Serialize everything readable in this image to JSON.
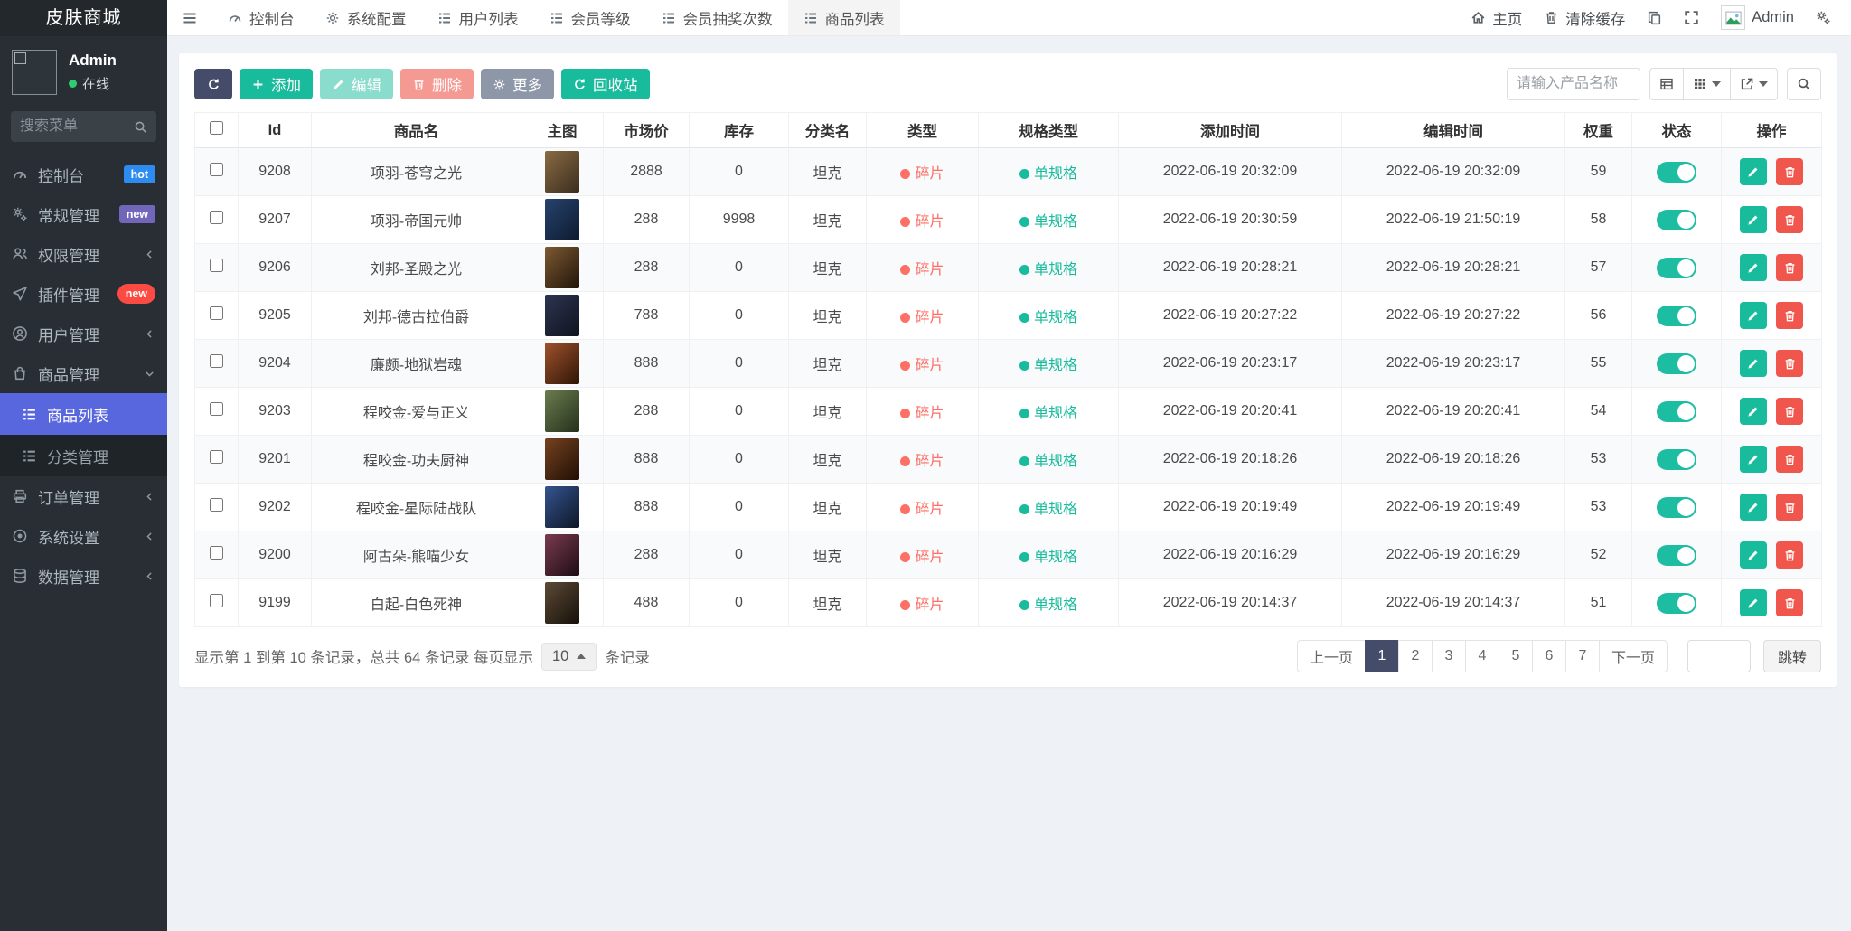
{
  "app": {
    "title": "皮肤商城"
  },
  "colors": {
    "teal": "#18bc9c",
    "danger_red": "#f0564c",
    "dark_navy": "#444c69",
    "muted_gray": "#8d97a8",
    "sidebar_active_blue": "#5867dd",
    "badge_hot_blue": "#2d8cf0",
    "badge_new_purple": "#7266ba",
    "badge_new_red": "#fb4b43",
    "type_red": "#fd7065",
    "type_green": "#18bc9c",
    "toggle_green": "#1dbda1"
  },
  "user_panel": {
    "name": "Admin",
    "status": "在线"
  },
  "sidebar": {
    "search_placeholder": "搜索菜单",
    "items": [
      {
        "label": "控制台",
        "badge": "hot"
      },
      {
        "label": "常规管理",
        "badge": "new"
      },
      {
        "label": "权限管理"
      },
      {
        "label": "插件管理",
        "badge": "new"
      },
      {
        "label": "用户管理"
      },
      {
        "label": "商品管理"
      },
      {
        "label": "订单管理"
      },
      {
        "label": "系统设置"
      },
      {
        "label": "数据管理"
      }
    ],
    "subitems": [
      {
        "label": "商品列表",
        "active": true
      },
      {
        "label": "分类管理"
      }
    ]
  },
  "navbar": {
    "tabs": [
      {
        "label": "控制台"
      },
      {
        "label": "系统配置"
      },
      {
        "label": "用户列表"
      },
      {
        "label": "会员等级"
      },
      {
        "label": "会员抽奖次数"
      },
      {
        "label": "商品列表"
      }
    ],
    "home": "主页",
    "clear_cache": "清除缓存",
    "user": "Admin"
  },
  "toolbar": {
    "add": "添加",
    "edit": "编辑",
    "delete": "删除",
    "more": "更多",
    "recycle": "回收站",
    "search_placeholder": "请输入产品名称"
  },
  "table": {
    "headers": [
      "Id",
      "商品名",
      "主图",
      "市场价",
      "库存",
      "分类名",
      "类型",
      "规格类型",
      "添加时间",
      "编辑时间",
      "权重",
      "状态",
      "操作"
    ],
    "rows": [
      {
        "id": "9208",
        "name": "项羽-苍穹之光",
        "price": "2888",
        "stock": "0",
        "category": "坦克",
        "type": "碎片",
        "spec": "单规格",
        "added": "2022-06-19 20:32:09",
        "edited": "2022-06-19 20:32:09",
        "weight": "59"
      },
      {
        "id": "9207",
        "name": "项羽-帝国元帅",
        "price": "288",
        "stock": "9998",
        "category": "坦克",
        "type": "碎片",
        "spec": "单规格",
        "added": "2022-06-19 20:30:59",
        "edited": "2022-06-19 21:50:19",
        "weight": "58"
      },
      {
        "id": "9206",
        "name": "刘邦-圣殿之光",
        "price": "288",
        "stock": "0",
        "category": "坦克",
        "type": "碎片",
        "spec": "单规格",
        "added": "2022-06-19 20:28:21",
        "edited": "2022-06-19 20:28:21",
        "weight": "57"
      },
      {
        "id": "9205",
        "name": "刘邦-德古拉伯爵",
        "price": "788",
        "stock": "0",
        "category": "坦克",
        "type": "碎片",
        "spec": "单规格",
        "added": "2022-06-19 20:27:22",
        "edited": "2022-06-19 20:27:22",
        "weight": "56"
      },
      {
        "id": "9204",
        "name": "廉颇-地狱岩魂",
        "price": "888",
        "stock": "0",
        "category": "坦克",
        "type": "碎片",
        "spec": "单规格",
        "added": "2022-06-19 20:23:17",
        "edited": "2022-06-19 20:23:17",
        "weight": "55"
      },
      {
        "id": "9203",
        "name": "程咬金-爱与正义",
        "price": "288",
        "stock": "0",
        "category": "坦克",
        "type": "碎片",
        "spec": "单规格",
        "added": "2022-06-19 20:20:41",
        "edited": "2022-06-19 20:20:41",
        "weight": "54"
      },
      {
        "id": "9201",
        "name": "程咬金-功夫厨神",
        "price": "888",
        "stock": "0",
        "category": "坦克",
        "type": "碎片",
        "spec": "单规格",
        "added": "2022-06-19 20:18:26",
        "edited": "2022-06-19 20:18:26",
        "weight": "53"
      },
      {
        "id": "9202",
        "name": "程咬金-星际陆战队",
        "price": "888",
        "stock": "0",
        "category": "坦克",
        "type": "碎片",
        "spec": "单规格",
        "added": "2022-06-19 20:19:49",
        "edited": "2022-06-19 20:19:49",
        "weight": "53"
      },
      {
        "id": "9200",
        "name": "阿古朵-熊喵少女",
        "price": "288",
        "stock": "0",
        "category": "坦克",
        "type": "碎片",
        "spec": "单规格",
        "added": "2022-06-19 20:16:29",
        "edited": "2022-06-19 20:16:29",
        "weight": "52"
      },
      {
        "id": "9199",
        "name": "白起-白色死神",
        "price": "488",
        "stock": "0",
        "category": "坦克",
        "type": "碎片",
        "spec": "单规格",
        "added": "2022-06-19 20:14:37",
        "edited": "2022-06-19 20:14:37",
        "weight": "51"
      }
    ]
  },
  "footer": {
    "info_prefix": "显示第 1 到第 10 条记录，总共 64 条记录 每页显示",
    "page_size": "10",
    "info_suffix": "条记录",
    "prev": "上一页",
    "pages": [
      "1",
      "2",
      "3",
      "4",
      "5",
      "6",
      "7"
    ],
    "next": "下一页",
    "jump": "跳转"
  }
}
